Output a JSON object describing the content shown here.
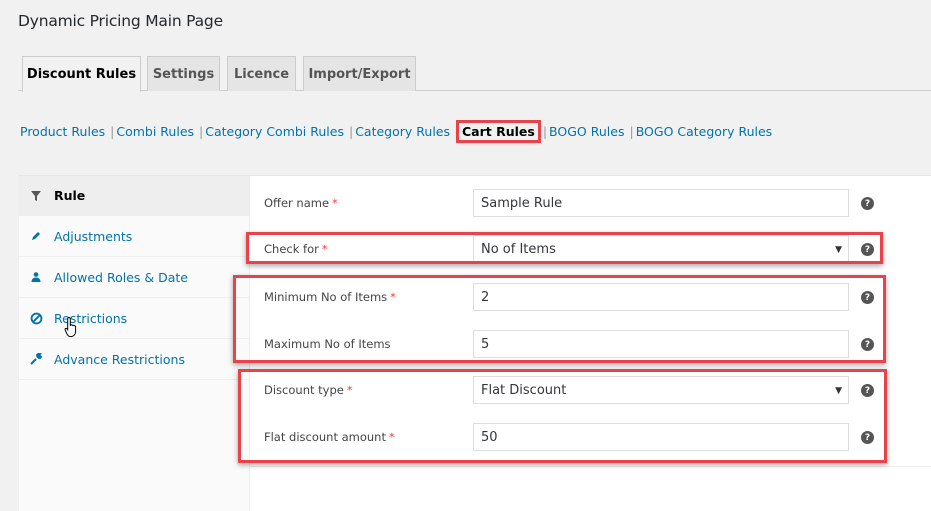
{
  "page": {
    "title": "Dynamic Pricing Main Page"
  },
  "tabs": [
    {
      "label": "Discount Rules",
      "active": true
    },
    {
      "label": "Settings",
      "active": false
    },
    {
      "label": "Licence",
      "active": false
    },
    {
      "label": "Import/Export",
      "active": false
    }
  ],
  "rule_links": [
    {
      "label": "Product Rules"
    },
    {
      "label": "Combi Rules"
    },
    {
      "label": "Category Combi Rules"
    },
    {
      "label": "Category Rules"
    },
    {
      "label": "Cart Rules",
      "current": true
    },
    {
      "label": "BOGO Rules"
    },
    {
      "label": "BOGO Category Rules"
    }
  ],
  "sidebar": {
    "items": [
      {
        "label": "Rule",
        "icon": "filter-icon",
        "active": true
      },
      {
        "label": "Adjustments",
        "icon": "pencil-icon"
      },
      {
        "label": "Allowed Roles & Date",
        "icon": "user-icon"
      },
      {
        "label": "Restrictions",
        "icon": "ban-icon"
      },
      {
        "label": "Advance Restrictions",
        "icon": "wrench-icon"
      }
    ]
  },
  "form": {
    "required_mark": "*",
    "help_glyph": "?",
    "dropdown_caret": "▼",
    "fields": [
      {
        "label": "Offer name",
        "required": true,
        "type": "text",
        "value": "Sample Rule"
      },
      {
        "label": "Check for",
        "required": true,
        "type": "select",
        "value": "No of Items"
      },
      {
        "label": "Minimum No of Items",
        "required": true,
        "type": "text",
        "value": "2"
      },
      {
        "label": "Maximum No of Items",
        "required": false,
        "type": "text",
        "value": "5"
      },
      {
        "label": "Discount type",
        "required": true,
        "type": "select",
        "value": "Flat Discount"
      },
      {
        "label": "Flat discount amount",
        "required": true,
        "type": "text",
        "value": "50"
      }
    ]
  },
  "colors": {
    "link": "#0073aa",
    "highlight": "#e8434a",
    "required": "#e8434a"
  }
}
